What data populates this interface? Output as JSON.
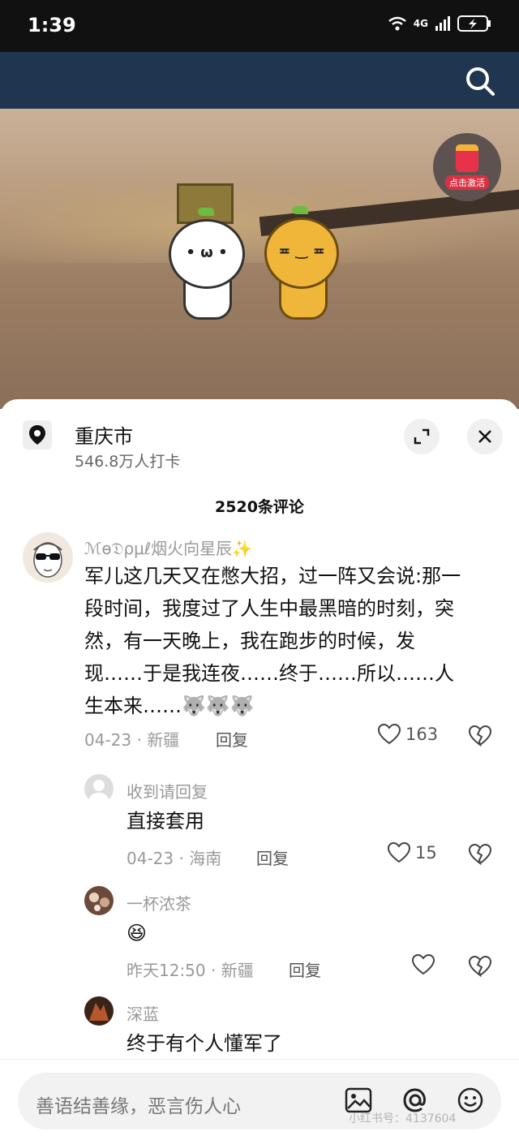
{
  "status": {
    "time": "1:39",
    "network": "4G"
  },
  "location": {
    "title": "重庆市",
    "subtitle": "546.8万人打卡"
  },
  "ad": {
    "label": "点击激活"
  },
  "comments_count": "2520条评论",
  "comments": [
    {
      "user": "ℳѳ𝔇ρμℓ烟火向星辰✨",
      "text_lines": [
        "军儿这几天又在憋大招，过一阵又会说:那一",
        "段时间，我度过了人生中最黑暗的时刻，突",
        "然，有一天晚上，我在跑步的时候，发",
        "现……于是我连夜……终于……所以……人",
        "生本来……🐺🐺🐺"
      ],
      "date": "04-23",
      "region": "新疆",
      "reply": "回复",
      "likes": "163"
    },
    {
      "user": "收到请回复",
      "text": "直接套用",
      "date": "04-23",
      "region": "海南",
      "reply": "回复",
      "likes": "15"
    },
    {
      "user": "一杯浓茶",
      "text": "😆",
      "date": "昨天12:50",
      "region": "新疆",
      "reply": "回复",
      "likes": ""
    },
    {
      "user": "深蓝",
      "text": "终于有个人懂军了"
    }
  ],
  "input": {
    "placeholder": "善语结善缘，恶言伤人心"
  },
  "watermark": "小红书号：4137604",
  "sep": "·"
}
